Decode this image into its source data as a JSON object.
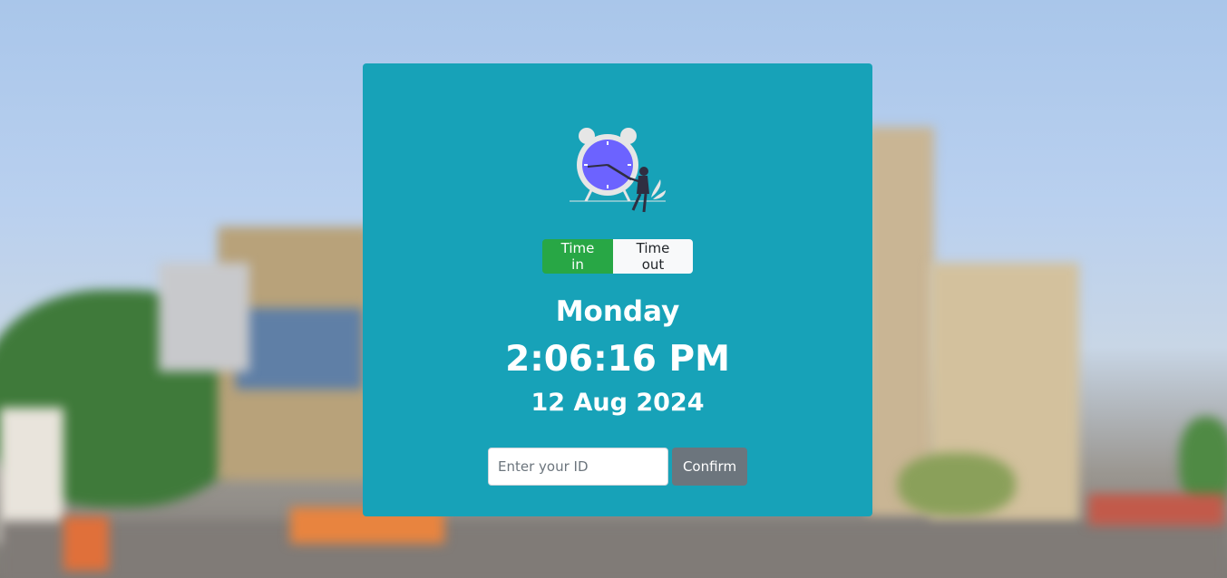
{
  "buttons": {
    "time_in": "Time in",
    "time_out": "Time out",
    "confirm": "Confirm"
  },
  "clock": {
    "day": "Monday",
    "time": "2:06:16 PM",
    "date": "12 Aug 2024"
  },
  "id_field": {
    "placeholder": "Enter your ID",
    "value": ""
  },
  "colors": {
    "card": "#17a2b8",
    "time_in_active": "#28a745",
    "time_out": "#f8f9fa",
    "confirm": "#6c757d",
    "clock_face": "#6c63ff"
  },
  "icons": {
    "illustration": "alarm-clock-person-icon"
  }
}
